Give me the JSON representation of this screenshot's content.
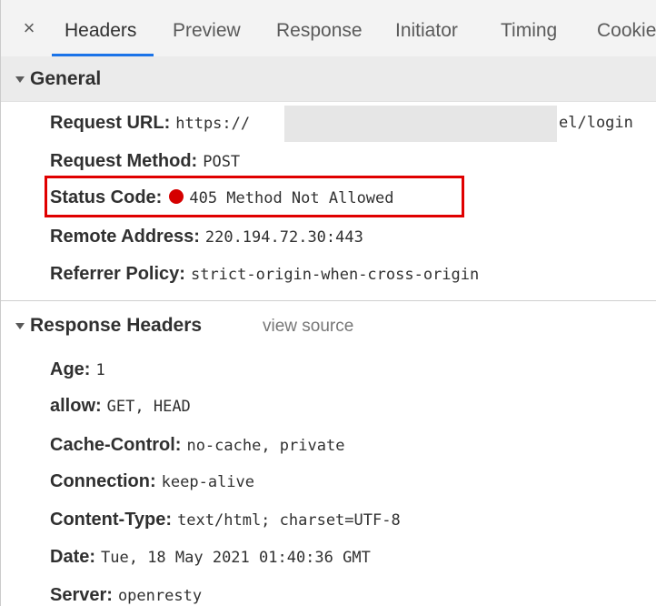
{
  "tabs": {
    "close_symbol": "×",
    "items": [
      "Headers",
      "Preview",
      "Response",
      "Initiator",
      "Timing",
      "Cookie"
    ],
    "active": "Headers"
  },
  "general": {
    "title": "General",
    "request_url_label": "Request URL:",
    "request_url_start": "https://",
    "request_url_end": "el/login",
    "request_method_label": "Request Method:",
    "request_method": "POST",
    "status_code_label": "Status Code:",
    "status_code": "405 Method Not Allowed",
    "status_color": "#d50000",
    "remote_address_label": "Remote Address:",
    "remote_address": "220.194.72.30:443",
    "referrer_policy_label": "Referrer Policy:",
    "referrer_policy": "strict-origin-when-cross-origin"
  },
  "response_headers": {
    "title": "Response Headers",
    "view_source": "view source",
    "items": [
      {
        "key": "Age:",
        "value": "1"
      },
      {
        "key": "allow:",
        "value": "GET, HEAD"
      },
      {
        "key": "Cache-Control:",
        "value": "no-cache, private"
      },
      {
        "key": "Connection:",
        "value": "keep-alive"
      },
      {
        "key": "Content-Type:",
        "value": "text/html; charset=UTF-8"
      },
      {
        "key": "Date:",
        "value": "Tue, 18 May 2021 01:40:36 GMT"
      },
      {
        "key": "Server:",
        "value": "openresty"
      }
    ]
  },
  "colors": {
    "accent": "#1a73e8",
    "highlight": "#e00000"
  }
}
